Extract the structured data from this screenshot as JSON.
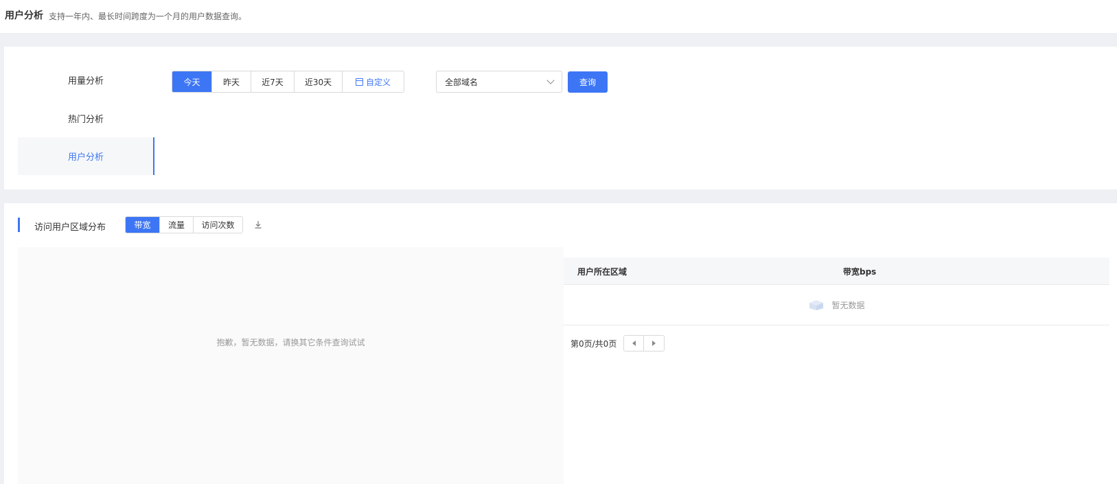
{
  "header": {
    "title": "用户分析",
    "description": "支持一年内、最长时间跨度为一个月的用户数据查询。"
  },
  "nav": {
    "items": [
      {
        "label": "用量分析"
      },
      {
        "label": "热门分析"
      },
      {
        "label": "用户分析"
      }
    ],
    "active_index": 2
  },
  "filters": {
    "date_options": [
      "今天",
      "昨天",
      "近7天",
      "近30天"
    ],
    "custom_label": "自定义",
    "selected_date": "今天",
    "domain_select": "全部域名",
    "query_button": "查询"
  },
  "section": {
    "title": "访问用户区域分布",
    "metric_tabs": [
      "带宽",
      "流量",
      "访问次数"
    ],
    "selected_metric": "带宽"
  },
  "map": {
    "empty_message": "抱歉，暂无数据，请换其它条件查询试试"
  },
  "table": {
    "columns": [
      "用户所在区域",
      "带宽bps"
    ],
    "empty_text": "暂无数据"
  },
  "pagination": {
    "text": "第0页/共0页"
  },
  "colors": {
    "accent": "#3d76f5",
    "background": "#eef0f4"
  }
}
